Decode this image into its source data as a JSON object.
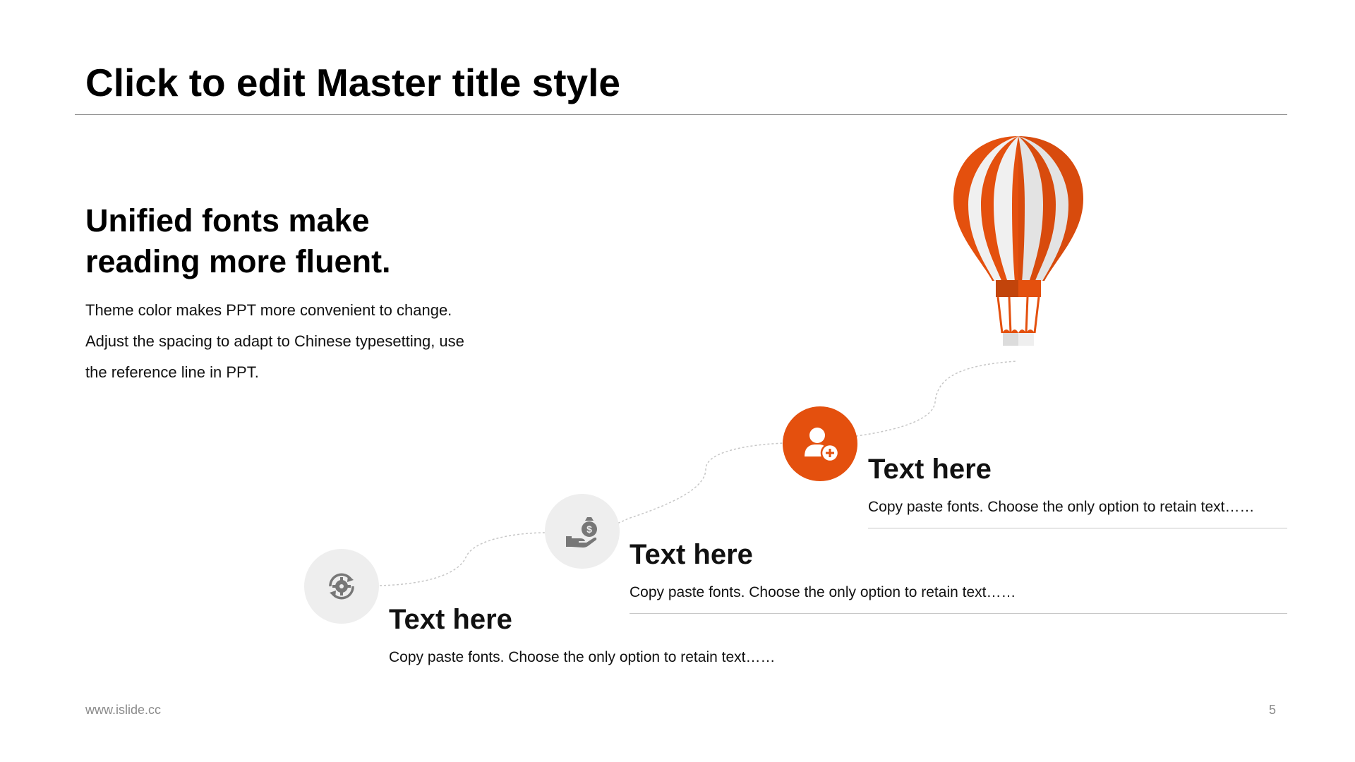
{
  "slide": {
    "title": "Click to edit Master title style",
    "heading_lines": [
      "Unified fonts make",
      "reading more fluent."
    ],
    "body_lines": [
      "Theme color makes PPT more convenient to change.",
      "Adjust the spacing to adapt to Chinese typesetting, use",
      "the reference line in PPT."
    ]
  },
  "steps": [
    {
      "icon": "gear-refresh-icon",
      "title": "Text here",
      "description": "Copy paste fonts. Choose the only option to retain text……"
    },
    {
      "icon": "money-hand-icon",
      "title": "Text here",
      "description": "Copy paste fonts. Choose the only option to retain text……"
    },
    {
      "icon": "add-user-icon",
      "title": "Text here",
      "description": "Copy paste fonts. Choose the only option to retain text……"
    }
  ],
  "footer": {
    "url": "www.islide.cc",
    "page_number": "5"
  },
  "colors": {
    "accent": "#e4500e",
    "icon_grey": "#777777",
    "circle_grey": "#eeeeee",
    "balloon_stripe_light": "#f0f0f0"
  }
}
